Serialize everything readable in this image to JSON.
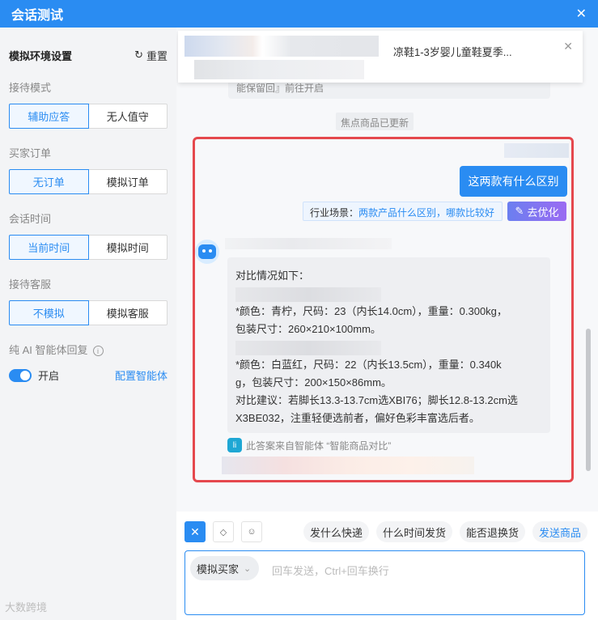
{
  "window": {
    "title": "会话测试",
    "close_icon": "✕"
  },
  "sidebar": {
    "header": "模拟环境设置",
    "reset_label": "重置",
    "reset_icon": "↻",
    "groups": [
      {
        "label": "接待模式",
        "options": [
          "辅助应答",
          "无人值守"
        ],
        "active": 0
      },
      {
        "label": "买家订单",
        "options": [
          "无订单",
          "模拟订单"
        ],
        "active": 0
      },
      {
        "label": "会话时间",
        "options": [
          "当前时间",
          "模拟时间"
        ],
        "active": 0
      },
      {
        "label": "接待客服",
        "options": [
          "不模拟",
          "模拟客服"
        ],
        "active": 0
      }
    ],
    "ai_label": "纯 AI 智能体回复",
    "info_icon": "i",
    "toggle_label": "开启",
    "toggle_on": true,
    "config_link": "配置智能体"
  },
  "chat": {
    "product_title": "凉鞋1-3岁婴儿童鞋夏季...",
    "product_close": "✕",
    "prev_text": "能保留回』前往开启",
    "system_note": "焦点商品已更新",
    "user_message": "这两款有什么区别",
    "hint_label": "行业场景：",
    "hint_value": "两款产品什么区别，哪款比较好",
    "optimize_icon": "✎",
    "optimize_label": "去优化",
    "bot_lines": [
      "对比情况如下：",
      "",
      "*颜色：青柠，尺码：23（内长14.0cm），重量：0.300kg，",
      "包装尺寸：260×210×100mm。",
      "",
      "*颜色：白蓝红，尺码：22（内长13.5cm），重量：0.340k",
      "g，包装尺寸：200×150×86mm。",
      "对比建议：若脚长13.3-13.7cm选XBI76；脚长12.8-13.2cm选",
      "X3BE032，注重轻便选前者，偏好色彩丰富选后者。"
    ],
    "source_icon": "li",
    "source_text": "此答案来自智能体 “智能商品对比”"
  },
  "toolbar": {
    "buttons": [
      "✕",
      "◇",
      "☺"
    ],
    "quick_replies": [
      "发什么快递",
      "什么时间发货",
      "能否退换货"
    ],
    "send_product": "发送商品"
  },
  "input": {
    "buyer_label": "模拟买家",
    "chevron": "⌄",
    "placeholder": "回车发送，Ctrl+回车换行"
  },
  "watermark": "大数跨境"
}
